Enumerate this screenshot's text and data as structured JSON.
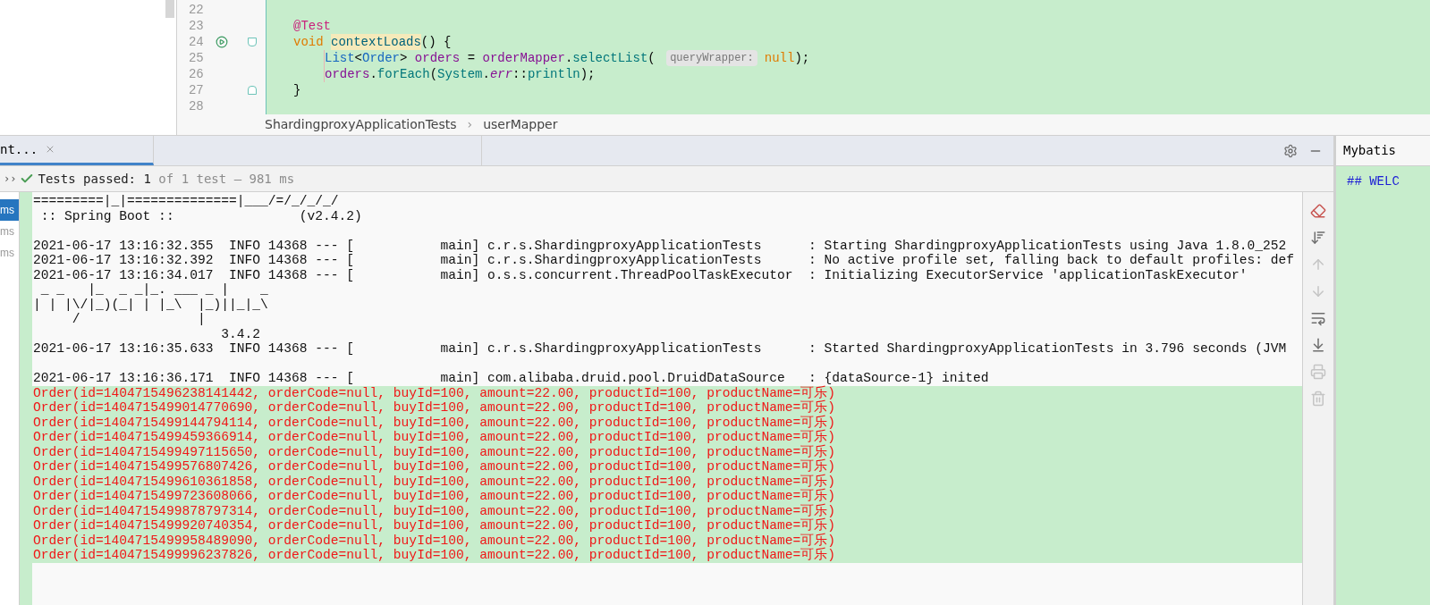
{
  "editor": {
    "lines": [
      {
        "number": "22"
      },
      {
        "number": "23",
        "tokens": [
          {
            "kind": "annotation",
            "text": "@Test"
          }
        ]
      },
      {
        "number": "24",
        "run": true,
        "fold_open": true,
        "tokens": [
          {
            "kind": "keyword",
            "text": "void "
          },
          {
            "kind": "method-decl",
            "text": "contextLoads"
          },
          {
            "kind": "plain",
            "text": "() {"
          }
        ]
      },
      {
        "number": "25",
        "indent": true,
        "tokens": [
          {
            "kind": "type",
            "text": "List"
          },
          {
            "kind": "plain",
            "text": "<"
          },
          {
            "kind": "type",
            "text": "Order"
          },
          {
            "kind": "plain",
            "text": "> "
          },
          {
            "kind": "local",
            "text": "orders"
          },
          {
            "kind": "plain",
            "text": " = "
          },
          {
            "kind": "field",
            "text": "orderMapper"
          },
          {
            "kind": "plain",
            "text": "."
          },
          {
            "kind": "call",
            "text": "selectList"
          },
          {
            "kind": "plain",
            "text": "( "
          },
          {
            "kind": "hint",
            "text": "queryWrapper:"
          },
          {
            "kind": "keyword",
            "text": "null"
          },
          {
            "kind": "plain",
            "text": ");"
          }
        ]
      },
      {
        "number": "26",
        "indent": true,
        "tokens": [
          {
            "kind": "local",
            "text": "orders"
          },
          {
            "kind": "plain",
            "text": "."
          },
          {
            "kind": "call",
            "text": "forEach"
          },
          {
            "kind": "plain",
            "text": "("
          },
          {
            "kind": "call",
            "text": "System"
          },
          {
            "kind": "plain",
            "text": "."
          },
          {
            "kind": "static",
            "text": "err"
          },
          {
            "kind": "plain",
            "text": "::"
          },
          {
            "kind": "call",
            "text": "println"
          },
          {
            "kind": "plain",
            "text": ");"
          }
        ]
      },
      {
        "number": "27",
        "fold_close": true,
        "tokens": [
          {
            "kind": "plain",
            "text": "}"
          }
        ]
      },
      {
        "number": "28"
      }
    ]
  },
  "breadcrumb": {
    "separator": "›",
    "items": [
      "ShardingproxyApplicationTests",
      "userMapper"
    ]
  },
  "run_panel": {
    "tab": {
      "label": "nt...",
      "selected": true
    },
    "status": {
      "expander": "››",
      "label": "Tests passed:",
      "count": "1",
      "detail": "of 1 test – 981 ms"
    },
    "test_items": [
      {
        "label": "ms",
        "selected": true
      },
      {
        "label": "ms",
        "selected": false
      },
      {
        "label": "ms",
        "selected": false
      }
    ],
    "console": [
      {
        "kind": "out",
        "text": "=========|_|==============|___/=/_/_/_/"
      },
      {
        "kind": "out",
        "text": " :: Spring Boot ::                (v2.4.2)"
      },
      {
        "kind": "blank"
      },
      {
        "kind": "out",
        "text": "2021-06-17 13:16:32.355  INFO 14368 --- [           main] c.r.s.ShardingproxyApplicationTests      : Starting ShardingproxyApplicationTests using Java 1.8.0_252"
      },
      {
        "kind": "out",
        "text": "2021-06-17 13:16:32.392  INFO 14368 --- [           main] c.r.s.ShardingproxyApplicationTests      : No active profile set, falling back to default profiles: def"
      },
      {
        "kind": "out",
        "text": "2021-06-17 13:16:34.017  INFO 14368 --- [           main] o.s.s.concurrent.ThreadPoolTaskExecutor  : Initializing ExecutorService 'applicationTaskExecutor'"
      },
      {
        "kind": "out",
        "text": " _ _   |_  _ _|_. ___ _ |    _ "
      },
      {
        "kind": "out",
        "text": "| | |\\/|_)(_| | |_\\  |_)||_|_\\ "
      },
      {
        "kind": "out",
        "text": "     /               |         "
      },
      {
        "kind": "out",
        "text": "                        3.4.2 "
      },
      {
        "kind": "out",
        "text": "2021-06-17 13:16:35.633  INFO 14368 --- [           main] c.r.s.ShardingproxyApplicationTests      : Started ShardingproxyApplicationTests in 3.796 seconds (JVM"
      },
      {
        "kind": "blank"
      },
      {
        "kind": "out",
        "text": "2021-06-17 13:16:36.171  INFO 14368 --- [           main] com.alibaba.druid.pool.DruidDataSource   : {dataSource-1} inited"
      },
      {
        "kind": "err",
        "text": "Order(id=1404715496238141442, orderCode=null, buyId=100, amount=22.00, productId=100, productName=可乐)"
      },
      {
        "kind": "err",
        "text": "Order(id=1404715499014770690, orderCode=null, buyId=100, amount=22.00, productId=100, productName=可乐)"
      },
      {
        "kind": "err",
        "text": "Order(id=1404715499144794114, orderCode=null, buyId=100, amount=22.00, productId=100, productName=可乐)"
      },
      {
        "kind": "err",
        "text": "Order(id=1404715499459366914, orderCode=null, buyId=100, amount=22.00, productId=100, productName=可乐)"
      },
      {
        "kind": "err",
        "text": "Order(id=1404715499497115650, orderCode=null, buyId=100, amount=22.00, productId=100, productName=可乐)"
      },
      {
        "kind": "err",
        "text": "Order(id=1404715499576807426, orderCode=null, buyId=100, amount=22.00, productId=100, productName=可乐)"
      },
      {
        "kind": "err",
        "text": "Order(id=1404715499610361858, orderCode=null, buyId=100, amount=22.00, productId=100, productName=可乐)"
      },
      {
        "kind": "err",
        "text": "Order(id=1404715499723608066, orderCode=null, buyId=100, amount=22.00, productId=100, productName=可乐)"
      },
      {
        "kind": "err",
        "text": "Order(id=1404715499878797314, orderCode=null, buyId=100, amount=22.00, productId=100, productName=可乐)"
      },
      {
        "kind": "err",
        "text": "Order(id=1404715499920740354, orderCode=null, buyId=100, amount=22.00, productId=100, productName=可乐)"
      },
      {
        "kind": "err",
        "text": "Order(id=1404715499958489090, orderCode=null, buyId=100, amount=22.00, productId=100, productName=可乐)"
      },
      {
        "kind": "err",
        "text": "Order(id=1404715499996237826, orderCode=null, buyId=100, amount=22.00, productId=100, productName=可乐)"
      }
    ],
    "toolbar": [
      {
        "kind": "clear",
        "disabled": false
      },
      {
        "kind": "sort",
        "disabled": false
      },
      {
        "kind": "up",
        "disabled": true
      },
      {
        "kind": "down",
        "disabled": true
      },
      {
        "kind": "wrap",
        "disabled": false
      },
      {
        "kind": "scroll-end",
        "disabled": false
      },
      {
        "kind": "print",
        "disabled": true
      },
      {
        "kind": "delete",
        "disabled": true
      }
    ]
  },
  "side_panel": {
    "title": "Mybatis",
    "text": "## WELC"
  }
}
